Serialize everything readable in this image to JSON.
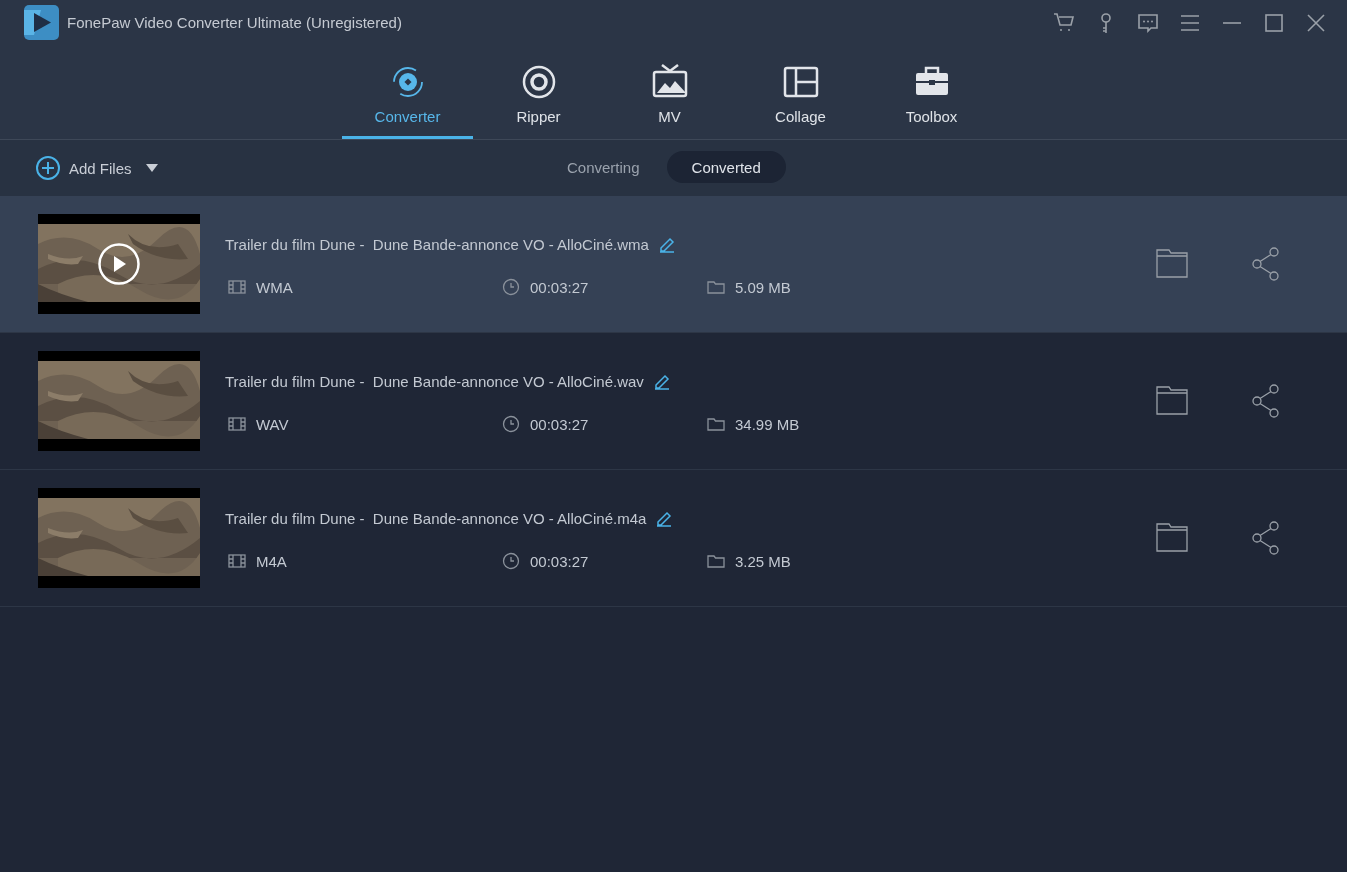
{
  "window": {
    "title": "FonePaw Video Converter Ultimate (Unregistered)"
  },
  "nav_tabs": [
    {
      "label": "Converter",
      "kind": "converter",
      "selected": true
    },
    {
      "label": "Ripper",
      "kind": "ripper",
      "selected": false
    },
    {
      "label": "MV",
      "kind": "mv",
      "selected": false
    },
    {
      "label": "Collage",
      "kind": "collage",
      "selected": false
    },
    {
      "label": "Toolbox",
      "kind": "toolbox",
      "selected": false
    }
  ],
  "toolbar": {
    "add_files": "Add Files",
    "view_tabs": [
      {
        "label": "Converting",
        "selected": false
      },
      {
        "label": "Converted",
        "selected": true
      }
    ]
  },
  "files": [
    {
      "name": "Trailer du film Dune -  Dune Bande-annonce VO - AlloCiné.wma",
      "format": "WMA",
      "duration": "00:03:27",
      "size": "5.09 MB",
      "selected": true
    },
    {
      "name": "Trailer du film Dune -  Dune Bande-annonce VO - AlloCiné.wav",
      "format": "WAV",
      "duration": "00:03:27",
      "size": "34.99 MB",
      "selected": false
    },
    {
      "name": "Trailer du film Dune -  Dune Bande-annonce VO - AlloCiné.m4a",
      "format": "M4A",
      "duration": "00:03:27",
      "size": "3.25 MB",
      "selected": false
    }
  ]
}
